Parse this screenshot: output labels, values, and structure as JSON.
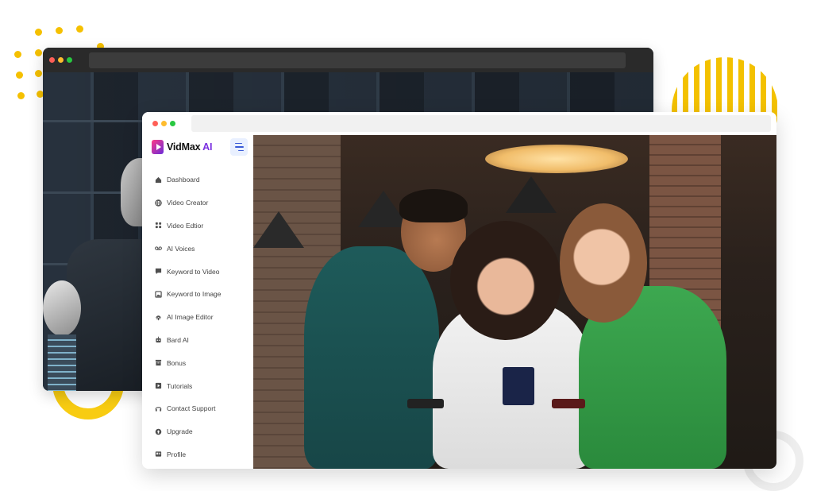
{
  "app": {
    "brand_name": "VidMax",
    "brand_suffix": "AI"
  },
  "sidebar": {
    "items": [
      {
        "label": "Dashboard",
        "icon": "home-icon"
      },
      {
        "label": "Video Creator",
        "icon": "globe-icon"
      },
      {
        "label": "Video Edtior",
        "icon": "grid-icon"
      },
      {
        "label": "AI Voices",
        "icon": "voicemail-icon"
      },
      {
        "label": "Keyword to Video",
        "icon": "message-icon"
      },
      {
        "label": "Keyword to Image",
        "icon": "image-icon"
      },
      {
        "label": "AI Image Editor",
        "icon": "fingerprint-icon"
      },
      {
        "label": "Bard AI",
        "icon": "bot-icon"
      },
      {
        "label": "Bonus",
        "icon": "archive-icon"
      },
      {
        "label": "Tutorials",
        "icon": "play-square-icon"
      },
      {
        "label": "Contact Support",
        "icon": "headset-icon"
      },
      {
        "label": "Upgrade",
        "icon": "upgrade-icon"
      },
      {
        "label": "Profile",
        "icon": "id-card-icon"
      }
    ]
  },
  "colors": {
    "accent_yellow": "#f5c000",
    "brand_gradient_start": "#ff3c86",
    "brand_gradient_end": "#6a2bd9",
    "toggle_bg": "#e9f0ff",
    "traffic_red": "#ff5f57",
    "traffic_yellow": "#febc2e",
    "traffic_green": "#28c840"
  }
}
